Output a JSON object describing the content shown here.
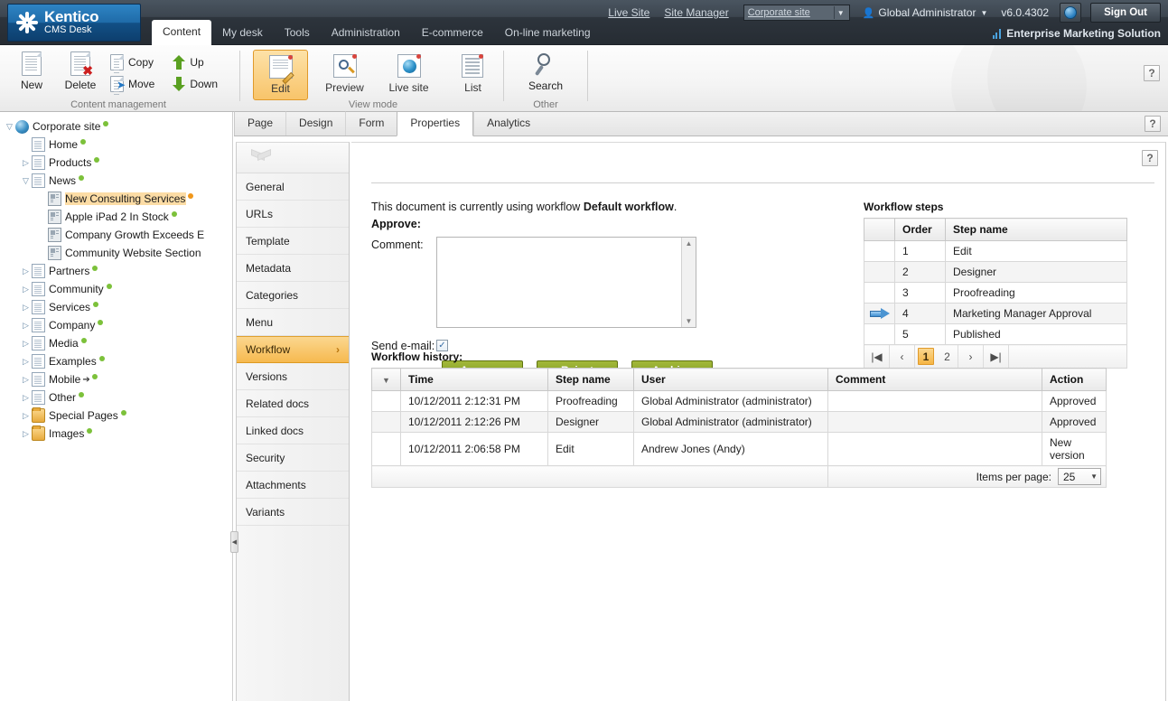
{
  "brand": {
    "name": "Kentico",
    "product": "CMS Desk",
    "logo_icon": "kentico-starburst-logo"
  },
  "topbar": {
    "tabs": [
      {
        "label": "Content",
        "active": true
      },
      {
        "label": "My desk",
        "active": false
      },
      {
        "label": "Tools",
        "active": false
      },
      {
        "label": "Administration",
        "active": false
      },
      {
        "label": "E-commerce",
        "active": false
      },
      {
        "label": "On-line marketing",
        "active": false
      }
    ],
    "live_site_link": "Live Site",
    "site_manager_link": "Site Manager",
    "site_selector_value": "Corporate site",
    "user_name": "Global Administrator",
    "version": "v6.0.4302",
    "sign_out": "Sign Out",
    "edition": "Enterprise Marketing Solution"
  },
  "ribbon": {
    "groups": [
      {
        "label": "Content management",
        "buttons": [
          {
            "label": "New",
            "icon": "new-document-icon"
          },
          {
            "label": "Delete",
            "icon": "delete-document-icon"
          },
          {
            "label": "Copy",
            "icon": "copy-icon"
          },
          {
            "label": "Move",
            "icon": "move-icon"
          },
          {
            "label": "Up",
            "icon": "arrow-up-icon"
          },
          {
            "label": "Down",
            "icon": "arrow-down-icon"
          }
        ]
      },
      {
        "label": "View mode",
        "buttons": [
          {
            "label": "Edit",
            "icon": "edit-icon",
            "active": true
          },
          {
            "label": "Preview",
            "icon": "preview-icon"
          },
          {
            "label": "Live site",
            "icon": "live-site-icon"
          },
          {
            "label": "List",
            "icon": "list-icon"
          }
        ]
      },
      {
        "label": "Other",
        "buttons": [
          {
            "label": "Search",
            "icon": "search-icon"
          }
        ]
      }
    ],
    "help_label": "?"
  },
  "tree": [
    {
      "label": "Corporate site",
      "icon": "globe-icon",
      "depth": 0,
      "expander": "expanded",
      "dot": "green"
    },
    {
      "label": "Home",
      "icon": "page-icon",
      "depth": 1,
      "expander": "none",
      "dot": "green"
    },
    {
      "label": "Products",
      "icon": "page-icon",
      "depth": 1,
      "expander": "collapsed",
      "dot": "green"
    },
    {
      "label": "News",
      "icon": "page-icon",
      "depth": 1,
      "expander": "expanded",
      "dot": "green"
    },
    {
      "label": "New Consulting Services",
      "icon": "news-icon",
      "depth": 2,
      "expander": "none",
      "dot": "orange",
      "selected": true
    },
    {
      "label": "Apple iPad 2 In Stock",
      "icon": "news-icon",
      "depth": 2,
      "expander": "none",
      "dot": "green"
    },
    {
      "label": "Company Growth Exceeds E",
      "icon": "news-icon",
      "depth": 2,
      "expander": "none",
      "dot": "none"
    },
    {
      "label": "Community Website Section",
      "icon": "news-icon",
      "depth": 2,
      "expander": "none",
      "dot": "none"
    },
    {
      "label": "Partners",
      "icon": "page-icon",
      "depth": 1,
      "expander": "collapsed",
      "dot": "green"
    },
    {
      "label": "Community",
      "icon": "page-icon",
      "depth": 1,
      "expander": "collapsed",
      "dot": "green"
    },
    {
      "label": "Services",
      "icon": "page-icon",
      "depth": 1,
      "expander": "collapsed",
      "dot": "green"
    },
    {
      "label": "Company",
      "icon": "page-icon",
      "depth": 1,
      "expander": "collapsed",
      "dot": "green"
    },
    {
      "label": "Media",
      "icon": "page-icon",
      "depth": 1,
      "expander": "collapsed",
      "dot": "green"
    },
    {
      "label": "Examples",
      "icon": "page-icon",
      "depth": 1,
      "expander": "collapsed",
      "dot": "green"
    },
    {
      "label": "Mobile",
      "icon": "page-icon",
      "depth": 1,
      "expander": "collapsed",
      "dot": "green",
      "extra": "link-arrow"
    },
    {
      "label": "Other",
      "icon": "page-icon",
      "depth": 1,
      "expander": "collapsed",
      "dot": "green"
    },
    {
      "label": "Special Pages",
      "icon": "folder-icon",
      "depth": 1,
      "expander": "collapsed",
      "dot": "green"
    },
    {
      "label": "Images",
      "icon": "folder-icon",
      "depth": 1,
      "expander": "collapsed",
      "dot": "green"
    }
  ],
  "subtabs": [
    {
      "label": "Page",
      "active": false
    },
    {
      "label": "Design",
      "active": false
    },
    {
      "label": "Form",
      "active": false
    },
    {
      "label": "Properties",
      "active": true
    },
    {
      "label": "Analytics",
      "active": false
    }
  ],
  "properties_menu": [
    {
      "label": "General",
      "active": false
    },
    {
      "label": "URLs",
      "active": false
    },
    {
      "label": "Template",
      "active": false
    },
    {
      "label": "Metadata",
      "active": false
    },
    {
      "label": "Categories",
      "active": false
    },
    {
      "label": "Menu",
      "active": false
    },
    {
      "label": "Workflow",
      "active": true,
      "chevron": "›"
    },
    {
      "label": "Versions",
      "active": false
    },
    {
      "label": "Related docs",
      "active": false
    },
    {
      "label": "Linked docs",
      "active": false
    },
    {
      "label": "Security",
      "active": false
    },
    {
      "label": "Attachments",
      "active": false
    },
    {
      "label": "Variants",
      "active": false
    }
  ],
  "workflow": {
    "intro_prefix": "This document is currently using workflow ",
    "intro_workflow_name": "Default workflow",
    "intro_suffix": ".",
    "approve_label": "Approve:",
    "comment_label": "Comment:",
    "comment_value": "",
    "send_email_label": "Send e-mail:",
    "send_email_checked": true,
    "buttons": [
      {
        "label": "Approve",
        "name": "approve-button"
      },
      {
        "label": "Reject",
        "name": "reject-button"
      },
      {
        "label": "Archive",
        "name": "archive-button"
      }
    ]
  },
  "workflow_steps": {
    "title": "Workflow steps",
    "columns": [
      "",
      "Order",
      "Step name"
    ],
    "rows": [
      {
        "current": false,
        "order": "1",
        "step": "Edit"
      },
      {
        "current": false,
        "order": "2",
        "step": "Designer"
      },
      {
        "current": false,
        "order": "3",
        "step": "Proofreading"
      },
      {
        "current": true,
        "order": "4",
        "step": "Marketing Manager Approval"
      },
      {
        "current": false,
        "order": "5",
        "step": "Published"
      }
    ],
    "pager": {
      "first": "|◀",
      "prev": "‹",
      "pages": [
        "1",
        "2"
      ],
      "current_page": "1",
      "next": "›",
      "last": "▶|"
    }
  },
  "workflow_history": {
    "title": "Workflow history:",
    "columns": [
      "",
      "Time",
      "Step name",
      "User",
      "Comment",
      "Action"
    ],
    "rows": [
      {
        "time": "10/12/2011 2:12:31 PM",
        "step": "Proofreading",
        "user": "Global Administrator (administrator)",
        "comment": "",
        "action": "Approved"
      },
      {
        "time": "10/12/2011 2:12:26 PM",
        "step": "Designer",
        "user": "Global Administrator (administrator)",
        "comment": "",
        "action": "Approved"
      },
      {
        "time": "10/12/2011 2:06:58 PM",
        "step": "Edit",
        "user": "Andrew Jones (Andy)",
        "comment": "",
        "action": "New version"
      }
    ],
    "items_per_page_label": "Items per page:",
    "items_per_page_value": "25"
  },
  "colors": {
    "accent_orange": "#f5b544",
    "header_dark": "#2d343c",
    "brand_blue": "#1f6ba8",
    "button_green": "#6e8412",
    "status_green": "#7cc13a",
    "status_orange": "#f0971a"
  }
}
